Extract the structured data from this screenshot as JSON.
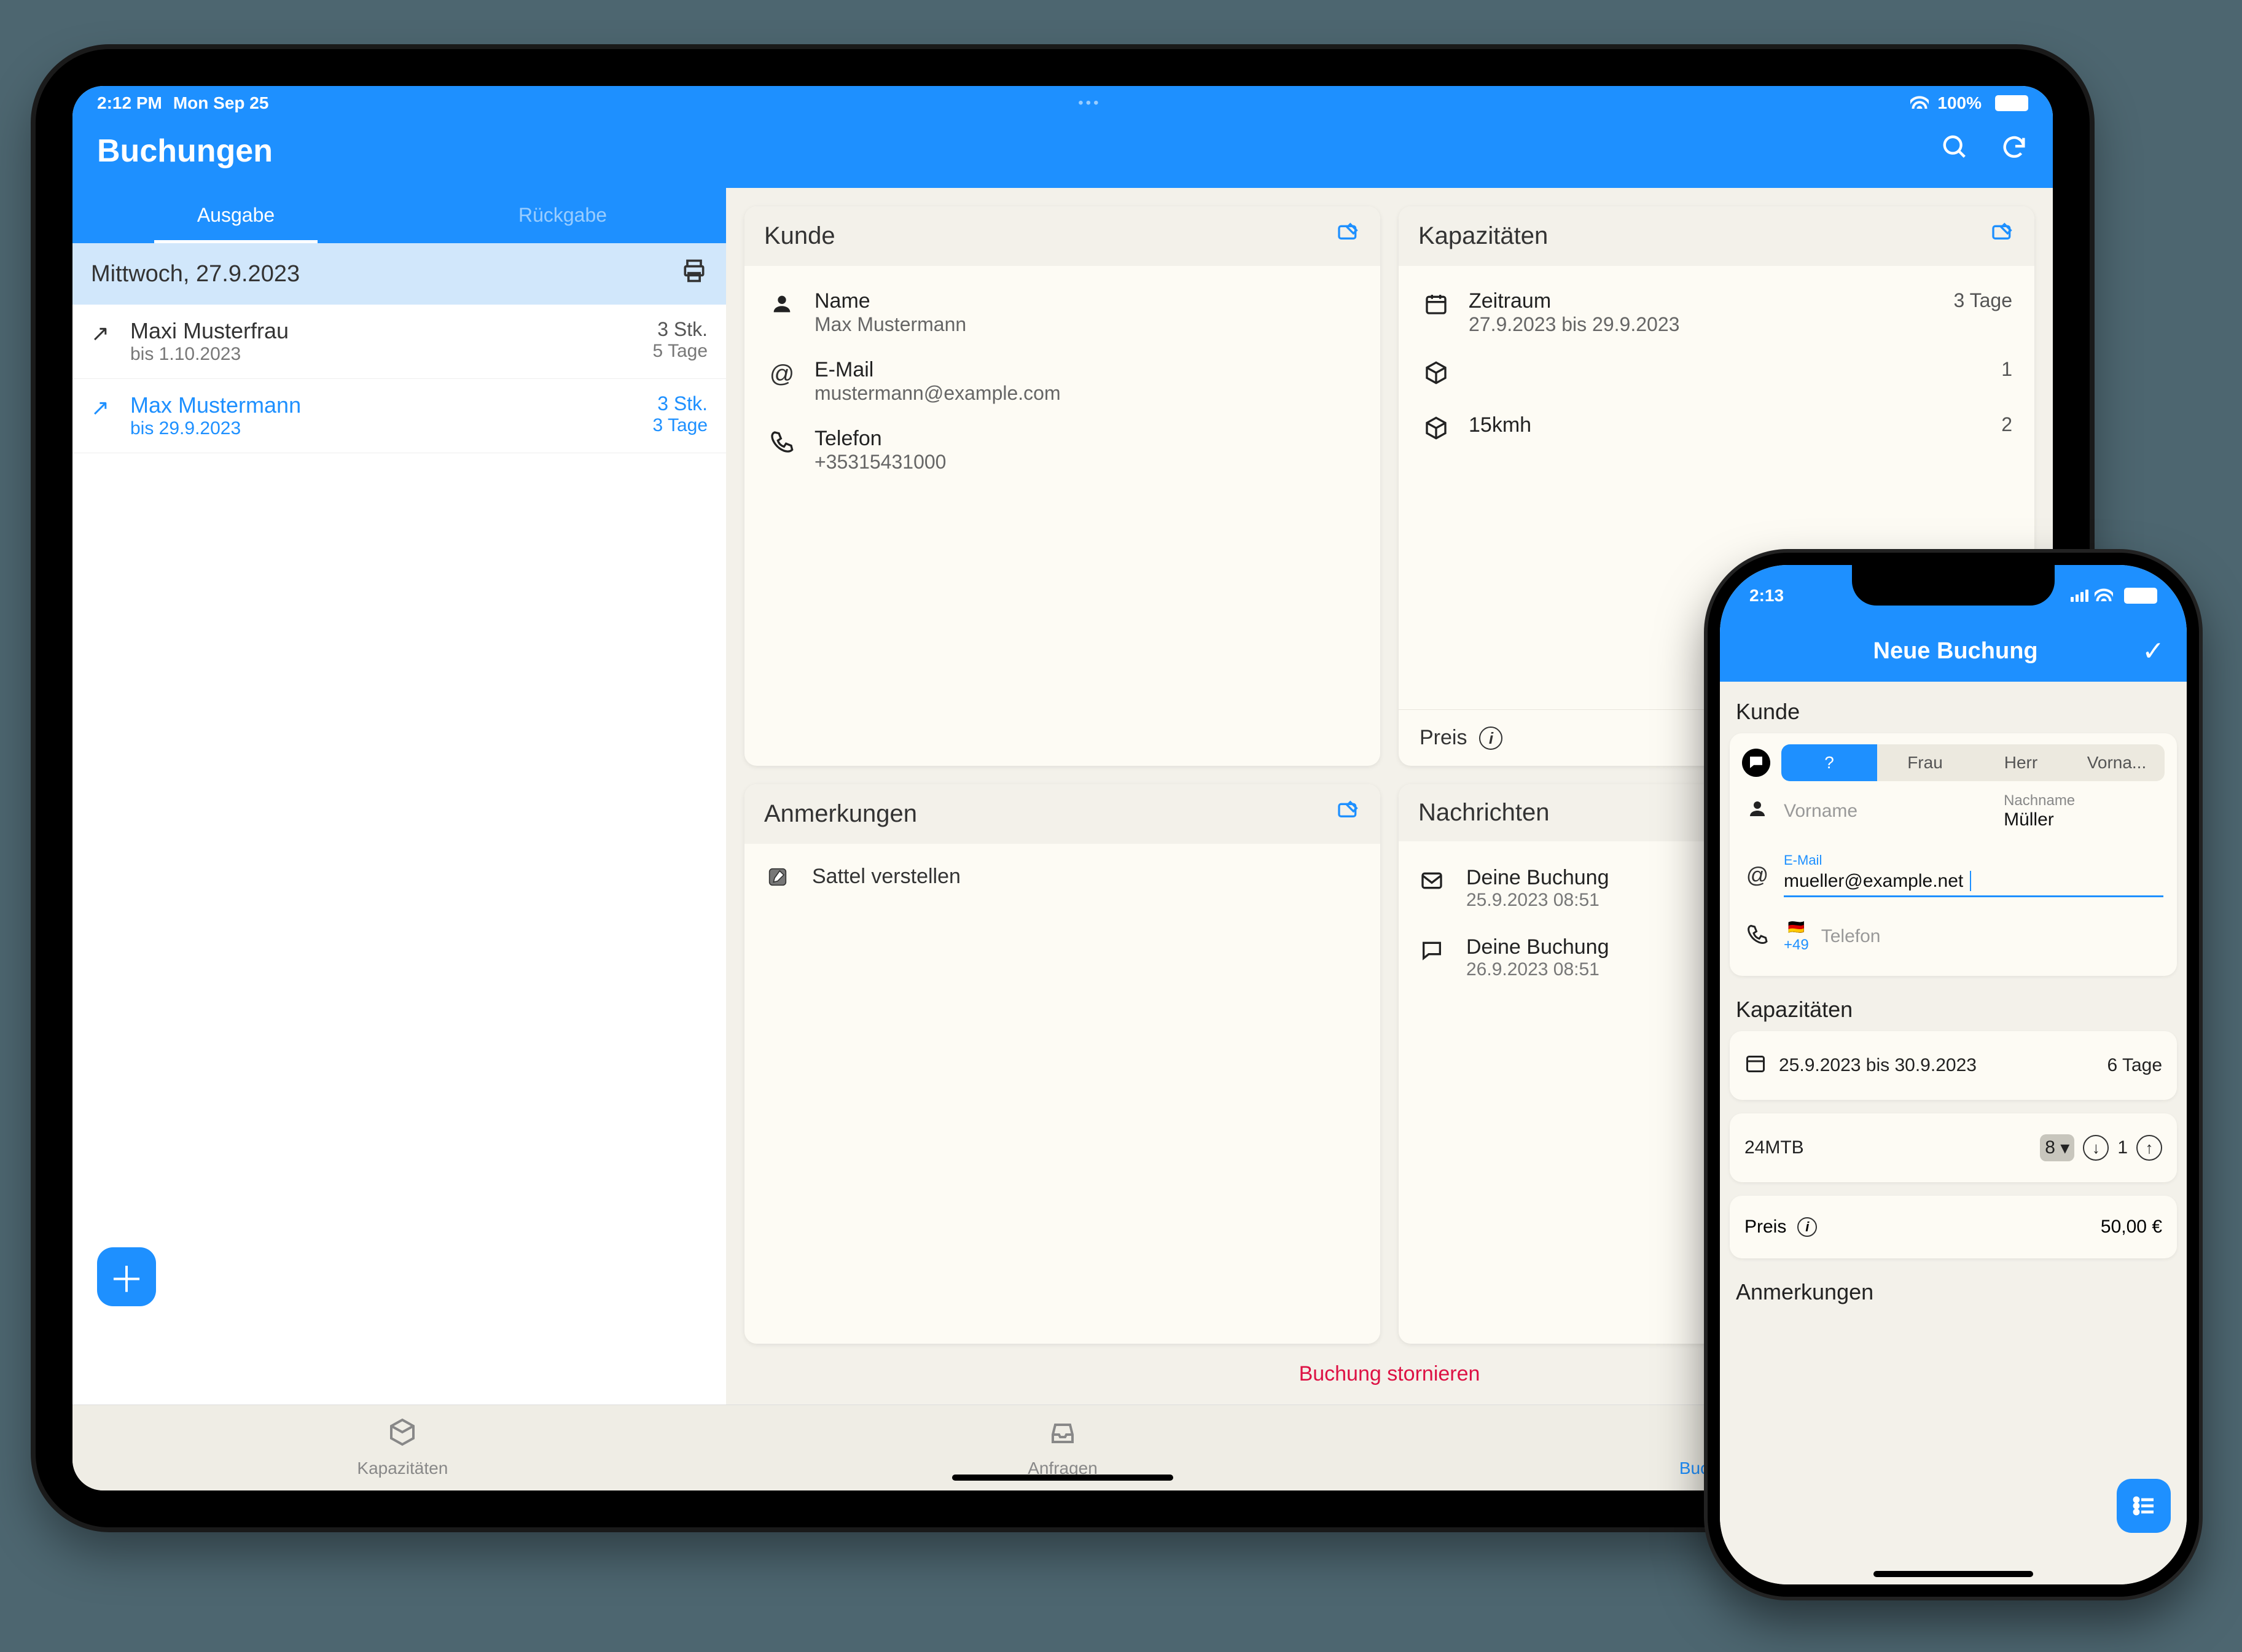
{
  "ipad": {
    "status": {
      "time": "2:12 PM",
      "date": "Mon Sep 25",
      "battery": "100%"
    },
    "header": {
      "title": "Buchungen"
    },
    "tabs": {
      "ausgabe": "Ausgabe",
      "rueckgabe": "Rückgabe"
    },
    "dateHeader": "Mittwoch, 27.9.2023",
    "bookings": [
      {
        "name": "Maxi Musterfrau",
        "until": "bis 1.10.2023",
        "qty": "3 Stk.",
        "days": "5 Tage"
      },
      {
        "name": "Max Mustermann",
        "until": "bis 29.9.2023",
        "qty": "3 Stk.",
        "days": "3 Tage"
      }
    ],
    "kunde": {
      "title": "Kunde",
      "nameLabel": "Name",
      "nameValue": "Max Mustermann",
      "emailLabel": "E-Mail",
      "emailValue": "mustermann@example.com",
      "phoneLabel": "Telefon",
      "phoneValue": "+35315431000"
    },
    "kapazitaeten": {
      "title": "Kapazitäten",
      "periodLabel": "Zeitraum",
      "periodValue": "27.9.2023 bis 29.9.2023",
      "periodDays": "3 Tage",
      "item1Count": "1",
      "item2Name": "15kmh",
      "item2Count": "2",
      "preisLabel": "Preis"
    },
    "anmerkungen": {
      "title": "Anmerkungen",
      "note1": "Sattel verstellen"
    },
    "nachrichten": {
      "title": "Nachrichten",
      "msgs": [
        {
          "title": "Deine Buchung",
          "sub": "25.9.2023 08:51"
        },
        {
          "title": "Deine Buchung",
          "sub": "26.9.2023 08:51"
        }
      ]
    },
    "cancel": "Buchung stornieren",
    "tabbar": {
      "kap": "Kapazitäten",
      "anf": "Anfragen",
      "buch": "Buchungen"
    }
  },
  "iphone": {
    "status": {
      "time": "2:13"
    },
    "title": "Neue Buchung",
    "kundeTitle": "Kunde",
    "salutation": {
      "unknown": "?",
      "frau": "Frau",
      "herr": "Herr",
      "vorname": "Vorna..."
    },
    "vornamePh": "Vorname",
    "nachnameLabel": "Nachname",
    "nachnameValue": "Müller",
    "emailLabel": "E-Mail",
    "emailValue": "mueller@example.net",
    "phoneCC": "+49",
    "phonePh": "Telefon",
    "kapTitle": "Kapazitäten",
    "period": "25.9.2023 bis 30.9.2023",
    "periodDays": "6 Tage",
    "itemName": "24MTB",
    "itemQtyA": "8",
    "itemQtyB": "1",
    "preisLabel": "Preis",
    "preisValue": "50,00 €",
    "anmerkungenTitle": "Anmerkungen"
  }
}
